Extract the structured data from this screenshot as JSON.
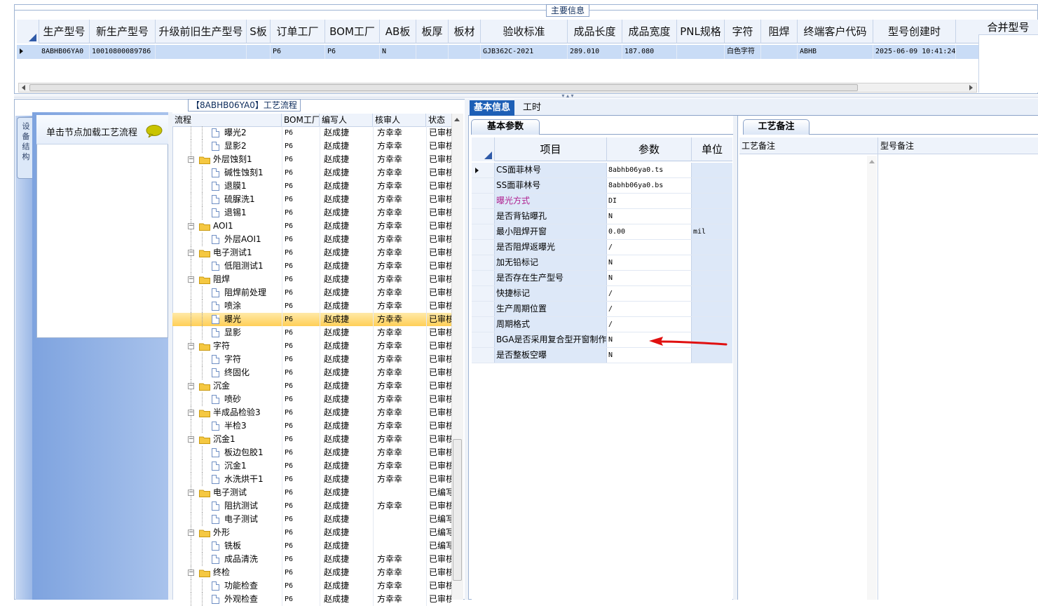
{
  "main_info": {
    "label": "主要信息"
  },
  "top_grid": {
    "columns": [
      "生产型号",
      "新生产型号",
      "升级前旧生产型号",
      "S板",
      "订单工厂",
      "BOM工厂",
      "AB板",
      "板厚",
      "板材",
      "验收标准",
      "成品长度",
      "成品宽度",
      "PNL规格",
      "字符",
      "阻焊",
      "终端客户代码",
      "型号创建时"
    ],
    "row": [
      "8ABHB06YA0",
      "10010800089786",
      "",
      "",
      "P6",
      "P6",
      "N",
      "",
      "",
      "GJB362C-2021",
      "289.010",
      "187.080",
      "",
      "白色字符",
      "",
      "ABHB",
      "2025-06-09 10:41:24"
    ],
    "merge_column": "合并型号"
  },
  "flow_panel": {
    "label": "【8ABHB06YA0】工艺流程",
    "side_tab": "设 备 结 构",
    "load_hint": "单击节点加载工艺流程",
    "columns": [
      "流程",
      "BOM工厂",
      "编写人",
      "核审人",
      "状态"
    ]
  },
  "tree_rows": [
    {
      "level": 2,
      "name": "曝光2",
      "bom": "P6",
      "writer": "赵成捷",
      "checker": "方幸幸",
      "status": "已审核"
    },
    {
      "level": 2,
      "name": "显影2",
      "bom": "P6",
      "writer": "赵成捷",
      "checker": "方幸幸",
      "status": "已审核"
    },
    {
      "level": 1,
      "name": "外层蚀刻1",
      "bom": "P6",
      "writer": "赵成捷",
      "checker": "方幸幸",
      "status": "已审核"
    },
    {
      "level": 2,
      "name": "碱性蚀刻1",
      "bom": "P6",
      "writer": "赵成捷",
      "checker": "方幸幸",
      "status": "已审核"
    },
    {
      "level": 2,
      "name": "退膜1",
      "bom": "P6",
      "writer": "赵成捷",
      "checker": "方幸幸",
      "status": "已审核"
    },
    {
      "level": 2,
      "name": "硫脲洗1",
      "bom": "P6",
      "writer": "赵成捷",
      "checker": "方幸幸",
      "status": "已审核"
    },
    {
      "level": 2,
      "name": "退锡1",
      "bom": "P6",
      "writer": "赵成捷",
      "checker": "方幸幸",
      "status": "已审核"
    },
    {
      "level": 1,
      "name": "AOI1",
      "bom": "P6",
      "writer": "赵成捷",
      "checker": "方幸幸",
      "status": "已审核"
    },
    {
      "level": 2,
      "name": "外层AOI1",
      "bom": "P6",
      "writer": "赵成捷",
      "checker": "方幸幸",
      "status": "已审核"
    },
    {
      "level": 1,
      "name": "电子测试1",
      "bom": "P6",
      "writer": "赵成捷",
      "checker": "方幸幸",
      "status": "已审核"
    },
    {
      "level": 2,
      "name": "低阻测试1",
      "bom": "P6",
      "writer": "赵成捷",
      "checker": "方幸幸",
      "status": "已审核"
    },
    {
      "level": 1,
      "name": "阻焊",
      "bom": "P6",
      "writer": "赵成捷",
      "checker": "方幸幸",
      "status": "已审核"
    },
    {
      "level": 2,
      "name": "阻焊前处理",
      "bom": "P6",
      "writer": "赵成捷",
      "checker": "方幸幸",
      "status": "已审核"
    },
    {
      "level": 2,
      "name": "喷涂",
      "bom": "P6",
      "writer": "赵成捷",
      "checker": "方幸幸",
      "status": "已审核"
    },
    {
      "level": 2,
      "name": "曝光",
      "bom": "P6",
      "writer": "赵成捷",
      "checker": "方幸幸",
      "status": "已审核",
      "selected": true
    },
    {
      "level": 2,
      "name": "显影",
      "bom": "P6",
      "writer": "赵成捷",
      "checker": "方幸幸",
      "status": "已审核"
    },
    {
      "level": 1,
      "name": "字符",
      "bom": "P6",
      "writer": "赵成捷",
      "checker": "方幸幸",
      "status": "已审核"
    },
    {
      "level": 2,
      "name": "字符",
      "bom": "P6",
      "writer": "赵成捷",
      "checker": "方幸幸",
      "status": "已审核"
    },
    {
      "level": 2,
      "name": "终固化",
      "bom": "P6",
      "writer": "赵成捷",
      "checker": "方幸幸",
      "status": "已审核"
    },
    {
      "level": 1,
      "name": "沉金",
      "bom": "P6",
      "writer": "赵成捷",
      "checker": "方幸幸",
      "status": "已审核"
    },
    {
      "level": 2,
      "name": "喷砂",
      "bom": "P6",
      "writer": "赵成捷",
      "checker": "方幸幸",
      "status": "已审核"
    },
    {
      "level": 1,
      "name": "半成品检验3",
      "bom": "P6",
      "writer": "赵成捷",
      "checker": "方幸幸",
      "status": "已审核"
    },
    {
      "level": 2,
      "name": "半检3",
      "bom": "P6",
      "writer": "赵成捷",
      "checker": "方幸幸",
      "status": "已审核"
    },
    {
      "level": 1,
      "name": "沉金1",
      "bom": "P6",
      "writer": "赵成捷",
      "checker": "方幸幸",
      "status": "已审核"
    },
    {
      "level": 2,
      "name": "板边包胶1",
      "bom": "P6",
      "writer": "赵成捷",
      "checker": "方幸幸",
      "status": "已审核"
    },
    {
      "level": 2,
      "name": "沉金1",
      "bom": "P6",
      "writer": "赵成捷",
      "checker": "方幸幸",
      "status": "已审核"
    },
    {
      "level": 2,
      "name": "水洗烘干1",
      "bom": "P6",
      "writer": "赵成捷",
      "checker": "方幸幸",
      "status": "已审核"
    },
    {
      "level": 1,
      "name": "电子测试",
      "bom": "P6",
      "writer": "赵成捷",
      "checker": "",
      "status": "已编写"
    },
    {
      "level": 2,
      "name": "阻抗测试",
      "bom": "P6",
      "writer": "赵成捷",
      "checker": "方幸幸",
      "status": "已审核"
    },
    {
      "level": 2,
      "name": "电子测试",
      "bom": "P6",
      "writer": "赵成捷",
      "checker": "",
      "status": "已编写"
    },
    {
      "level": 1,
      "name": "外形",
      "bom": "P6",
      "writer": "赵成捷",
      "checker": "",
      "status": "已编写"
    },
    {
      "level": 2,
      "name": "铣板",
      "bom": "P6",
      "writer": "赵成捷",
      "checker": "",
      "status": "已编写"
    },
    {
      "level": 2,
      "name": "成品清洗",
      "bom": "P6",
      "writer": "赵成捷",
      "checker": "方幸幸",
      "status": "已审核"
    },
    {
      "level": 1,
      "name": "终检",
      "bom": "P6",
      "writer": "赵成捷",
      "checker": "方幸幸",
      "status": "已审核"
    },
    {
      "level": 2,
      "name": "功能检查",
      "bom": "P6",
      "writer": "赵成捷",
      "checker": "方幸幸",
      "status": "已审核"
    },
    {
      "level": 2,
      "name": "外观检查",
      "bom": "P6",
      "writer": "赵成捷",
      "checker": "方幸幸",
      "status": "已审核"
    }
  ],
  "detail_tabs": {
    "basic": "基本信息",
    "hours": "工时"
  },
  "params": {
    "tab": "基本参数",
    "columns": [
      "项目",
      "参数",
      "单位"
    ],
    "rows": [
      {
        "item": "CS面菲林号",
        "value": "8abhb06ya0.ts",
        "unit": "",
        "selected": true
      },
      {
        "item": "SS面菲林号",
        "value": "8abhb06ya0.bs",
        "unit": ""
      },
      {
        "item": "曝光方式",
        "value": "DI",
        "unit": "",
        "highlight": true
      },
      {
        "item": "是否背钻曝孔",
        "value": "N",
        "unit": ""
      },
      {
        "item": "最小阻焊开窗",
        "value": "0.00",
        "unit": "mil"
      },
      {
        "item": "是否阻焊返曝光",
        "value": "/",
        "unit": ""
      },
      {
        "item": "加无铅标记",
        "value": "N",
        "unit": ""
      },
      {
        "item": "是否存在生产型号",
        "value": "N",
        "unit": ""
      },
      {
        "item": "快捷标记",
        "value": "/",
        "unit": ""
      },
      {
        "item": "生产周期位置",
        "value": "/",
        "unit": ""
      },
      {
        "item": "周期格式",
        "value": "/",
        "unit": ""
      },
      {
        "item": "BGA是否采用复合型开窗制作",
        "value": "N",
        "unit": ""
      },
      {
        "item": "是否整板空曝",
        "value": "N",
        "unit": ""
      }
    ]
  },
  "remarks": {
    "tab": "工艺备注",
    "col1": "工艺备注",
    "col2": "型号备注"
  },
  "colors": {
    "highlight_text": "#b0218f",
    "annotation_arrow": "#e01010",
    "selected_row": "#ffcf57",
    "tab_active": "#1d5fb6"
  }
}
